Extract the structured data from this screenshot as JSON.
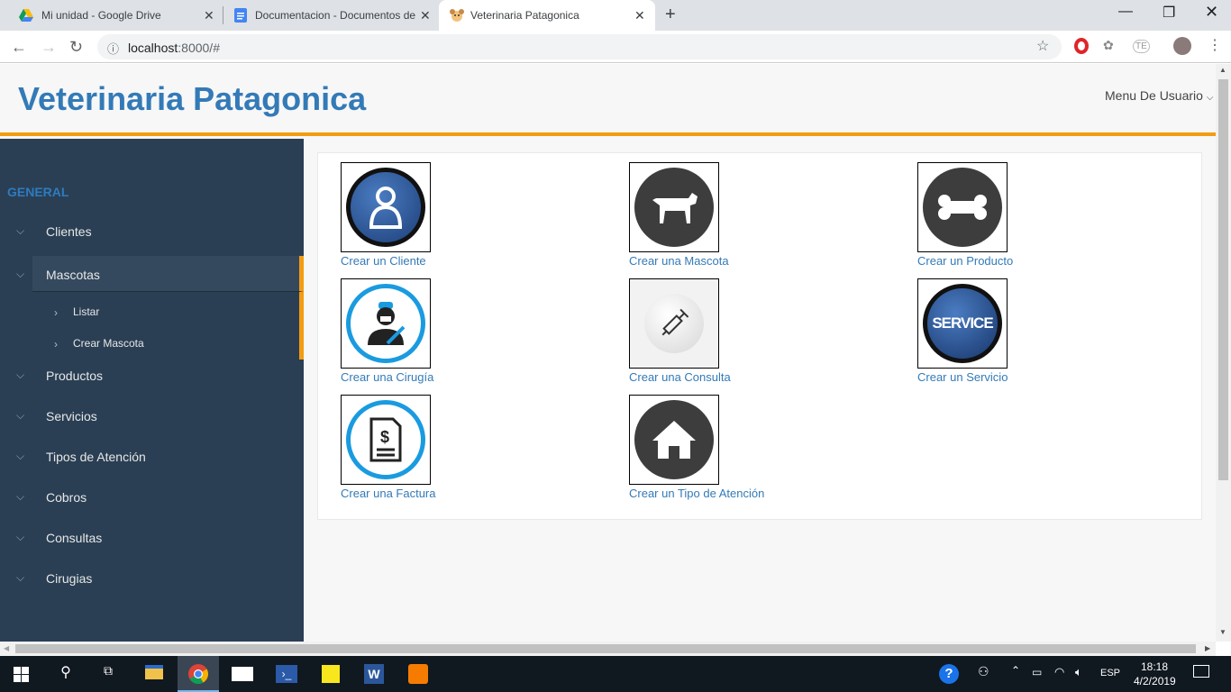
{
  "browser": {
    "tabs": [
      {
        "title": "Mi unidad - Google Drive"
      },
      {
        "title": "Documentacion - Documentos de Google"
      },
      {
        "title": "Veterinaria Patagonica"
      }
    ],
    "url_host": "localhost",
    "url_rest": ":8000/#"
  },
  "header": {
    "brand": "Veterinaria Patagonica",
    "user_menu": "Menu De Usuario"
  },
  "sidebar": {
    "section": "GENERAL",
    "items": [
      {
        "label": "Clientes"
      },
      {
        "label": "Mascotas"
      },
      {
        "label": "Productos"
      },
      {
        "label": "Servicios"
      },
      {
        "label": "Tipos de Atención"
      },
      {
        "label": "Cobros"
      },
      {
        "label": "Consultas"
      },
      {
        "label": "Cirugias"
      }
    ],
    "subitems": [
      {
        "label": "Listar"
      },
      {
        "label": "Crear Mascota"
      }
    ]
  },
  "cards": [
    {
      "label": "Crear un Cliente",
      "icon": "client-icon"
    },
    {
      "label": "Crear una Mascota",
      "icon": "dog-icon"
    },
    {
      "label": "Crear un Producto",
      "icon": "bone-icon"
    },
    {
      "label": "Crear una Cirugía",
      "icon": "surgeon-icon"
    },
    {
      "label": "Crear una Consulta",
      "icon": "syringe-icon"
    },
    {
      "label": "Crear un Servicio",
      "icon": "service-icon",
      "badge": "SERVICE"
    },
    {
      "label": "Crear una Factura",
      "icon": "invoice-icon"
    },
    {
      "label": "Crear un Tipo de Atención",
      "icon": "house-icon"
    }
  ],
  "taskbar": {
    "time": "18:18",
    "date": "4/2/2019",
    "lang": "ESP"
  },
  "colors": {
    "brand": "#337ab7",
    "accent": "#f39c12",
    "sidebar": "#2a3f54"
  }
}
